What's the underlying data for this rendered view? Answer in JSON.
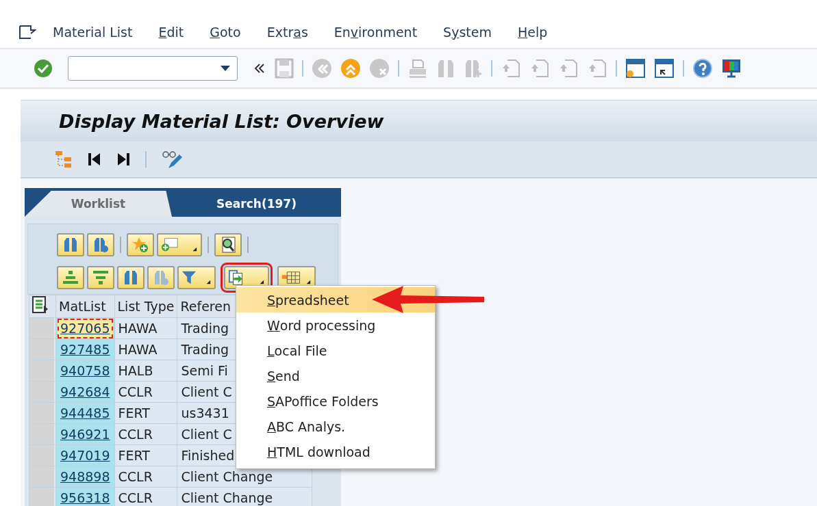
{
  "menu_bar": {
    "items": [
      {
        "parts": [
          {
            "text": "Material List",
            "underlined": false
          }
        ]
      },
      {
        "parts": [
          {
            "text": "E",
            "underlined": true
          },
          {
            "text": "dit",
            "underlined": false
          }
        ]
      },
      {
        "parts": [
          {
            "text": "G",
            "underlined": true
          },
          {
            "text": "oto",
            "underlined": false
          }
        ]
      },
      {
        "parts": [
          {
            "text": "Extr",
            "underlined": false
          },
          {
            "text": "a",
            "underlined": true
          },
          {
            "text": "s",
            "underlined": false
          }
        ]
      },
      {
        "parts": [
          {
            "text": "En",
            "underlined": false
          },
          {
            "text": "v",
            "underlined": true
          },
          {
            "text": "ironment",
            "underlined": false
          }
        ]
      },
      {
        "parts": [
          {
            "text": "S",
            "underlined": false
          },
          {
            "text": "y",
            "underlined": true
          },
          {
            "text": "stem",
            "underlined": false
          }
        ]
      },
      {
        "parts": [
          {
            "text": "H",
            "underlined": true
          },
          {
            "text": "elp",
            "underlined": false
          }
        ]
      }
    ]
  },
  "title": "Display Material List: Overview",
  "tabs": [
    {
      "label": "Worklist",
      "selected": false
    },
    {
      "label": "Search(197)",
      "selected": true
    }
  ],
  "table": {
    "columns": [
      "MatList",
      "List Type",
      "Referen"
    ],
    "rows": [
      {
        "matlist": "927065",
        "list_type": "HAWA",
        "reference": "Trading",
        "focused": true
      },
      {
        "matlist": "927485",
        "list_type": "HAWA",
        "reference": "Trading",
        "focused": false
      },
      {
        "matlist": "940758",
        "list_type": "HALB",
        "reference": "Semi Fi",
        "focused": false
      },
      {
        "matlist": "942684",
        "list_type": "CCLR",
        "reference": "Client C",
        "focused": false
      },
      {
        "matlist": "944485",
        "list_type": "FERT",
        "reference": "us3431",
        "focused": false
      },
      {
        "matlist": "946921",
        "list_type": "CCLR",
        "reference": "Client C",
        "focused": false
      },
      {
        "matlist": "947019",
        "list_type": "FERT",
        "reference": "Finished",
        "focused": false
      },
      {
        "matlist": "948898",
        "list_type": "CCLR",
        "reference": "Client Change",
        "focused": false
      },
      {
        "matlist": "956318",
        "list_type": "CCLR",
        "reference": "Client Change",
        "focused": false
      }
    ]
  },
  "export_menu": {
    "items": [
      {
        "parts": [
          {
            "text": "S",
            "underlined": true
          },
          {
            "text": "preadsheet",
            "underlined": false
          }
        ],
        "selected": true
      },
      {
        "parts": [
          {
            "text": "W",
            "underlined": true
          },
          {
            "text": "ord processing",
            "underlined": false
          }
        ],
        "selected": false
      },
      {
        "parts": [
          {
            "text": "L",
            "underlined": true
          },
          {
            "text": "ocal File",
            "underlined": false
          }
        ],
        "selected": false
      },
      {
        "parts": [
          {
            "text": "S",
            "underlined": true
          },
          {
            "text": "end",
            "underlined": false
          }
        ],
        "selected": false
      },
      {
        "parts": [
          {
            "text": "S",
            "underlined": true
          },
          {
            "text": "APoffice Folders",
            "underlined": false
          }
        ],
        "selected": false
      },
      {
        "parts": [
          {
            "text": "A",
            "underlined": true
          },
          {
            "text": "BC Analys.",
            "underlined": false
          }
        ],
        "selected": false
      },
      {
        "parts": [
          {
            "text": "H",
            "underlined": true
          },
          {
            "text": "TML download",
            "underlined": false
          }
        ],
        "selected": false
      }
    ]
  }
}
